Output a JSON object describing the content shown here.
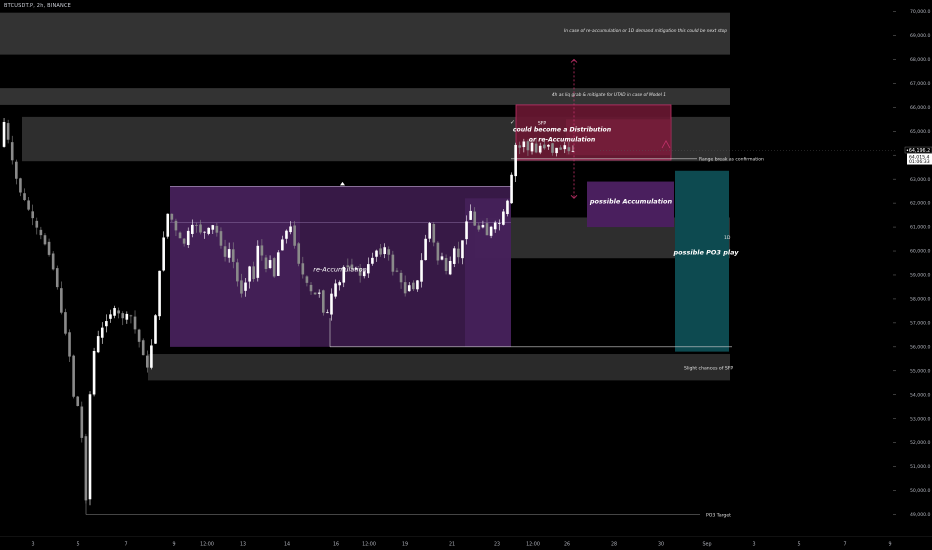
{
  "header": {
    "symbol": "BTCUSDT.P, 2h, BINANCE"
  },
  "chart_data": {
    "type": "candlestick",
    "symbol": "BTCUSDT.P",
    "interval": "2h",
    "exchange": "BINANCE",
    "ylim": [
      48800,
      70300
    ],
    "y_ticks": [
      "70,000.0",
      "69,000.0",
      "68,000.0",
      "67,000.0",
      "66,000.0",
      "65,000.0",
      "64,000.0",
      "63,000.0",
      "62,000.0",
      "61,000.0",
      "60,000.0",
      "59,000.0",
      "58,000.0",
      "57,000.0",
      "56,000.0",
      "55,000.0",
      "54,000.0",
      "53,000.0",
      "52,000.0",
      "51,000.0",
      "50,000.0",
      "49,000.0"
    ],
    "x_ticks": [
      "3",
      "5",
      "7",
      "9",
      "12:00",
      "13",
      "14",
      "16",
      "12:00",
      "19",
      "21",
      "23",
      "12:00",
      "26",
      "28",
      "30",
      "Sep",
      "3",
      "5",
      "7",
      "9"
    ],
    "price_labels": {
      "current": "64,015.4",
      "countdown": "01:06:33",
      "marker": "64,196.2"
    },
    "candles": {
      "waypoints": [
        [
          0,
          63000
        ],
        [
          4,
          65700
        ],
        [
          8,
          65100
        ],
        [
          13,
          64000
        ],
        [
          17,
          63200
        ],
        [
          22,
          62500
        ],
        [
          30,
          61800
        ],
        [
          38,
          61000
        ],
        [
          46,
          60400
        ],
        [
          52,
          59800
        ],
        [
          60,
          58400
        ],
        [
          64,
          57200
        ],
        [
          68,
          56500
        ],
        [
          72,
          55500
        ],
        [
          75,
          54000
        ],
        [
          80,
          53500
        ],
        [
          85,
          51800
        ],
        [
          88,
          49600
        ],
        [
          92,
          54000
        ],
        [
          96,
          55800
        ],
        [
          100,
          56400
        ],
        [
          108,
          57100
        ],
        [
          116,
          57600
        ],
        [
          124,
          57200
        ],
        [
          132,
          57400
        ],
        [
          138,
          56600
        ],
        [
          146,
          55600
        ],
        [
          150,
          55000
        ],
        [
          158,
          57500
        ],
        [
          164,
          60200
        ],
        [
          170,
          61600
        ],
        [
          174,
          61300
        ],
        [
          180,
          60600
        ],
        [
          186,
          60300
        ],
        [
          192,
          61000
        ],
        [
          198,
          61100
        ],
        [
          204,
          60700
        ],
        [
          210,
          60900
        ],
        [
          216,
          61100
        ],
        [
          222,
          60400
        ],
        [
          228,
          59600
        ],
        [
          232,
          60200
        ],
        [
          236,
          59400
        ],
        [
          240,
          58600
        ],
        [
          244,
          58200
        ],
        [
          248,
          58800
        ],
        [
          252,
          59400
        ],
        [
          256,
          58800
        ],
        [
          260,
          60300
        ],
        [
          264,
          59800
        ],
        [
          268,
          59200
        ],
        [
          272,
          59700
        ],
        [
          276,
          58900
        ],
        [
          280,
          59900
        ],
        [
          284,
          60500
        ],
        [
          288,
          60800
        ],
        [
          292,
          61100
        ],
        [
          296,
          60400
        ],
        [
          300,
          59600
        ],
        [
          304,
          59100
        ],
        [
          308,
          58700
        ],
        [
          312,
          58400
        ],
        [
          316,
          58000
        ],
        [
          320,
          58600
        ],
        [
          324,
          57600
        ],
        [
          328,
          57200
        ],
        [
          332,
          57800
        ],
        [
          336,
          58800
        ],
        [
          340,
          58300
        ],
        [
          344,
          59200
        ],
        [
          348,
          59500
        ],
        [
          352,
          59200
        ],
        [
          356,
          59400
        ],
        [
          360,
          59100
        ],
        [
          364,
          58900
        ],
        [
          368,
          59300
        ],
        [
          372,
          59500
        ],
        [
          376,
          59900
        ],
        [
          380,
          60100
        ],
        [
          384,
          59800
        ],
        [
          388,
          60300
        ],
        [
          392,
          59600
        ],
        [
          396,
          59000
        ],
        [
          400,
          59200
        ],
        [
          404,
          58500
        ],
        [
          408,
          58200
        ],
        [
          412,
          58700
        ],
        [
          416,
          58400
        ],
        [
          420,
          58800
        ],
        [
          424,
          59700
        ],
        [
          428,
          60600
        ],
        [
          432,
          61200
        ],
        [
          436,
          60300
        ],
        [
          440,
          59600
        ],
        [
          444,
          59800
        ],
        [
          448,
          59100
        ],
        [
          452,
          59500
        ],
        [
          456,
          60100
        ],
        [
          460,
          59700
        ],
        [
          464,
          60300
        ],
        [
          468,
          61200
        ],
        [
          472,
          61800
        ],
        [
          476,
          61100
        ],
        [
          480,
          60800
        ],
        [
          484,
          61300
        ],
        [
          488,
          60600
        ],
        [
          492,
          60900
        ],
        [
          496,
          61200
        ],
        [
          500,
          61000
        ],
        [
          504,
          61500
        ],
        [
          508,
          61800
        ],
        [
          512,
          62500
        ],
        [
          515,
          63700
        ],
        [
          518,
          64500
        ],
        [
          522,
          64300
        ],
        [
          526,
          64600
        ],
        [
          530,
          64200
        ],
        [
          534,
          64500
        ],
        [
          538,
          64100
        ],
        [
          542,
          64400
        ],
        [
          546,
          64300
        ],
        [
          550,
          64500
        ],
        [
          554,
          64100
        ],
        [
          558,
          64300
        ],
        [
          562,
          64200
        ],
        [
          566,
          64500
        ],
        [
          570,
          64100
        ],
        [
          575,
          64200
        ]
      ],
      "count": 140
    },
    "zones": [
      {
        "name": "upper-supply",
        "y": [
          68200,
          69950
        ],
        "x_end": "30"
      },
      {
        "name": "mid-supply",
        "y": [
          66100,
          66800
        ],
        "x_end": "30"
      },
      {
        "name": "ob-zone",
        "y": [
          63750,
          65600
        ],
        "x_start": "3",
        "x_end": "30"
      },
      {
        "name": "1d-demand",
        "y": [
          59700,
          61400
        ],
        "label": "1D"
      },
      {
        "name": "sfp-demand",
        "y": [
          54600,
          55700
        ],
        "label": "Slight chances of SFP"
      }
    ],
    "annotations": {
      "top_note": "In case of re-accumulation or 1D demand mitigation this could be next stop",
      "mid_note": "4h as liq grab & mitigate for UTAD in case of Model 1",
      "range_break": "Range break as confirmation",
      "reacc": "re-Accumulation",
      "sfp": "SFP",
      "dist_line1": "could become a Distribution",
      "dist_line2": "or re-Accumulation",
      "possible_acc": "possible Accumulation",
      "po3_play": "possible PO3 play",
      "one_d": "1D",
      "slight_sfp": "Slight chances of SFP",
      "po3_target": "PO3 Target"
    },
    "colors": {
      "up": "#ffffff",
      "down": "#8a8a8a",
      "purple": "#5b2a6e",
      "crimson": "#7a1f3d",
      "teal": "#0f4f55",
      "zone": "#3a3a3a"
    }
  }
}
